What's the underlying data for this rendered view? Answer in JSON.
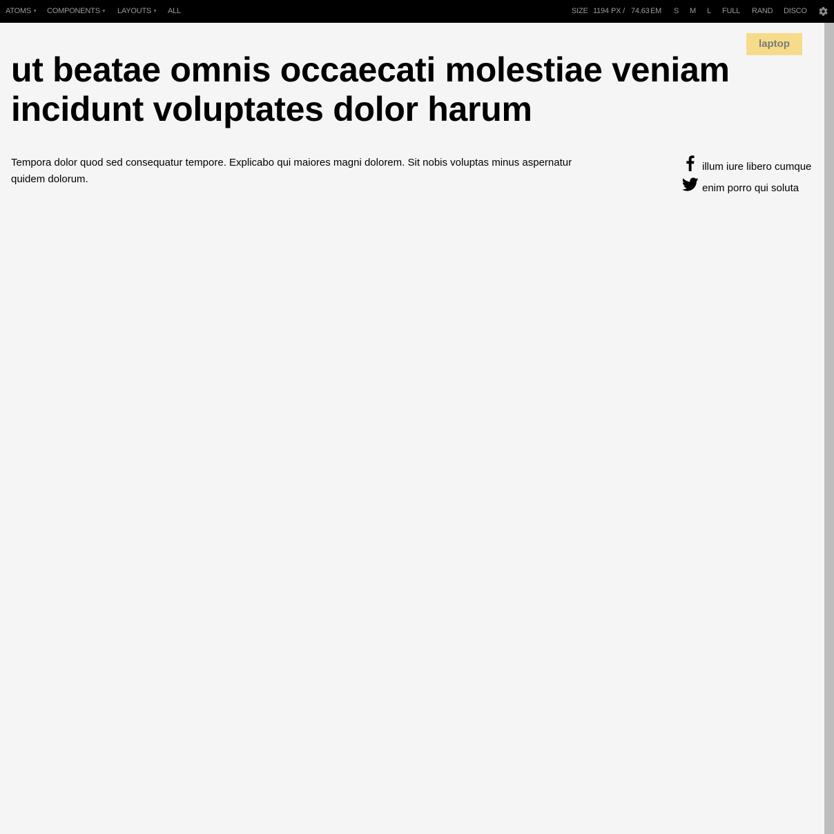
{
  "toolbar": {
    "nav": [
      {
        "label": "ATOMS",
        "has_dropdown": true
      },
      {
        "label": "COMPONENTS",
        "has_dropdown": true
      },
      {
        "label": "LAYOUTS",
        "has_dropdown": true
      },
      {
        "label": "ALL",
        "has_dropdown": false
      }
    ],
    "size_label": "SIZE",
    "size_px": "1194",
    "px_unit": "PX /",
    "size_em": "74.63",
    "em_unit": "EM",
    "presets": [
      "S",
      "M",
      "L",
      "FULL",
      "RAND",
      "DISCO"
    ],
    "settings_icon": "gear-icon"
  },
  "viewport": {
    "breakpoint_badge": "laptop",
    "headline": "ut beatae omnis occaecati molestiae veniam incidunt voluptates dolor harum",
    "intro": "Tempora dolor quod sed consequatur tempore. Explicabo qui maiores magni dolorem. Sit nobis voluptas minus aspernatur quidem dolorum.",
    "share": [
      {
        "icon": "facebook-icon",
        "label": "illum iure libero cumque"
      },
      {
        "icon": "twitter-icon",
        "label": "enim porro qui soluta"
      }
    ]
  },
  "colors": {
    "toolbar_bg": "#000000",
    "toolbar_text": "#9a9a9a",
    "page_bg": "#f5f5f5",
    "badge_bg": "#f6dc8a",
    "scrollbar": "#bdbdbd"
  }
}
